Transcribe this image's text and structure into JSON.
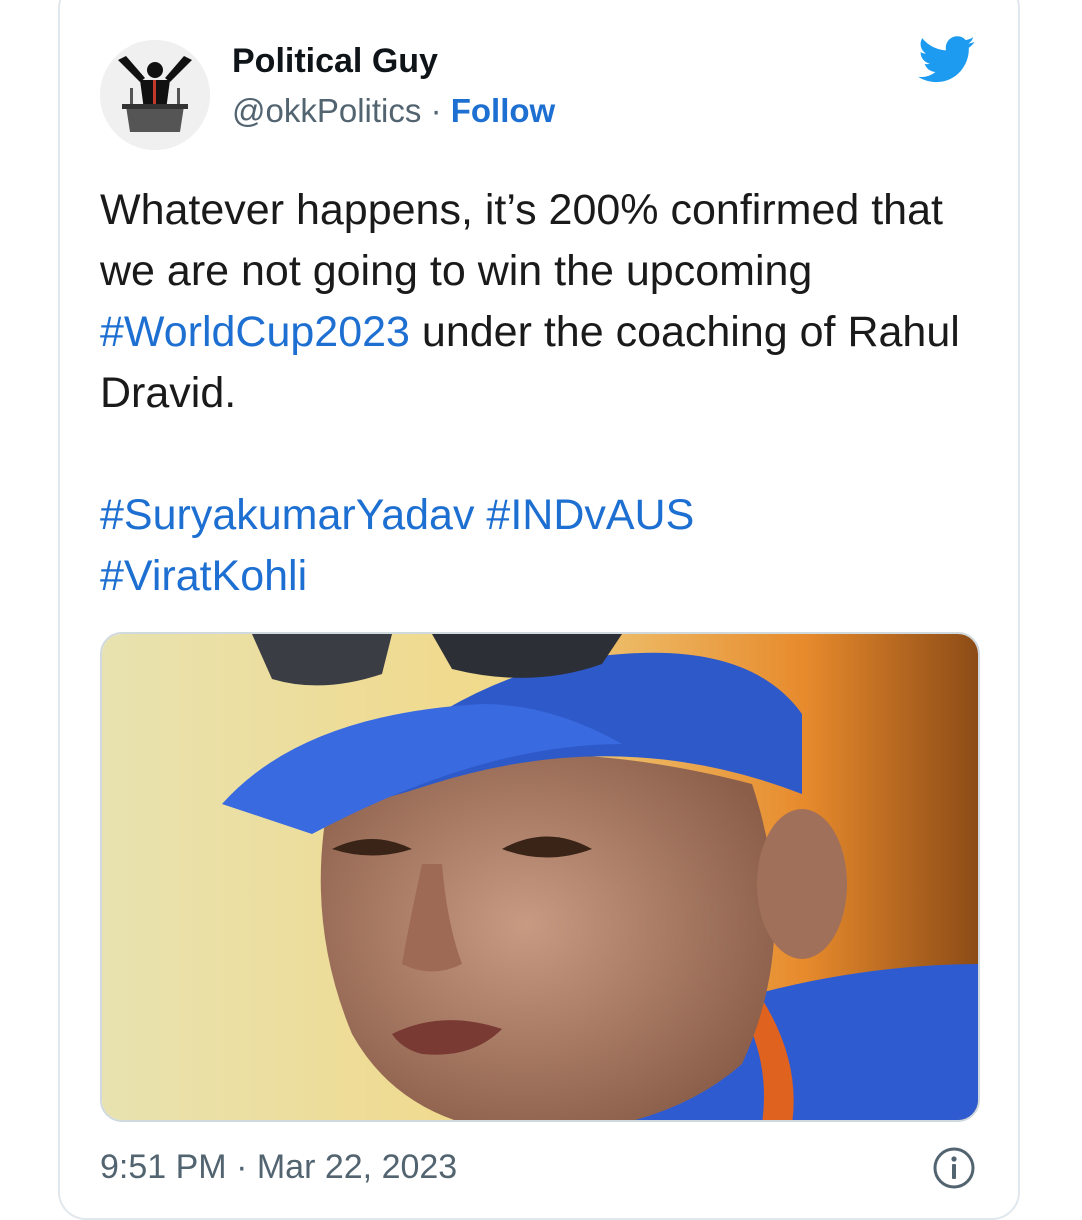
{
  "author": {
    "display_name": "Political Guy",
    "handle": "@okkPolitics",
    "separator": "·",
    "follow_label": "Follow",
    "avatar_icon": "politician-at-podium-avatar"
  },
  "brand": {
    "icon": "twitter-bird-icon",
    "color": "#1d9bf0"
  },
  "tweet": {
    "line1": "Whatever happens, it’s 200% confirmed that we are not going to win the upcoming ",
    "hashtag_worldcup": "#WorldCup2023",
    "line1_end": " under the coaching of Rahul Dravid.",
    "hashtag_surya": "#SuryakumarYadav",
    "hashtag_indvaus": "#INDvAUS",
    "hashtag_virat": "#ViratKohli"
  },
  "media": {
    "description_icon": "photo-of-man-in-blue-cap"
  },
  "footer": {
    "time": "9:51 PM",
    "separator": "·",
    "date": "Mar 22, 2023",
    "info_icon": "info-icon"
  },
  "colors": {
    "link": "#1d6fd1",
    "muted": "#536471",
    "border": "#e1e8ed"
  }
}
